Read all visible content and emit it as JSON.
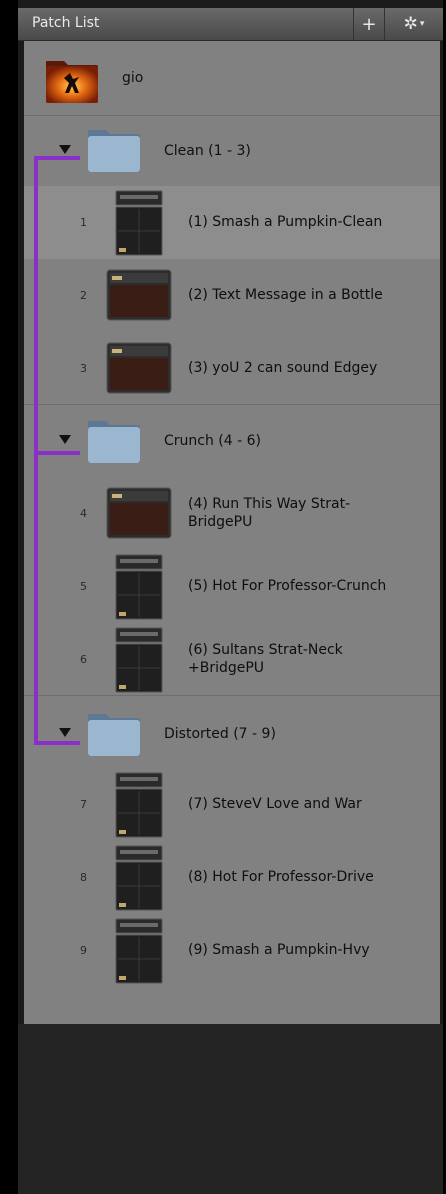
{
  "header": {
    "title": "Patch List",
    "add_label": "+",
    "settings_label": "✲"
  },
  "user": {
    "name": "gio"
  },
  "folders": [
    {
      "label": "Clean (1 - 3)"
    },
    {
      "label": "Crunch (4 - 6)"
    },
    {
      "label": "Distorted (7 - 9)"
    }
  ],
  "patches": [
    {
      "num": "1",
      "label": "(1) Smash a Pumpkin-Clean",
      "amp": "stack"
    },
    {
      "num": "2",
      "label": "(2) Text Message in a Bottle",
      "amp": "combo"
    },
    {
      "num": "3",
      "label": "(3) yoU 2 can sound Edgey",
      "amp": "combo"
    },
    {
      "num": "4",
      "label": "(4) Run This Way Strat-\nBridgePU",
      "amp": "combo"
    },
    {
      "num": "5",
      "label": "(5) Hot For Professor-Crunch",
      "amp": "stack"
    },
    {
      "num": "6",
      "label": "(6) Sultans Strat-Neck\n+BridgePU",
      "amp": "stack"
    },
    {
      "num": "7",
      "label": "(7) SteveV Love and War",
      "amp": "stack"
    },
    {
      "num": "8",
      "label": "(8) Hot For Professor-Drive",
      "amp": "stack"
    },
    {
      "num": "9",
      "label": "(9) Smash a Pumpkin-Hvy",
      "amp": "stack"
    }
  ],
  "colors": {
    "bracket": "#8a2fc8",
    "selected_row": "#8d8d8d",
    "list_bg": "#818181"
  }
}
